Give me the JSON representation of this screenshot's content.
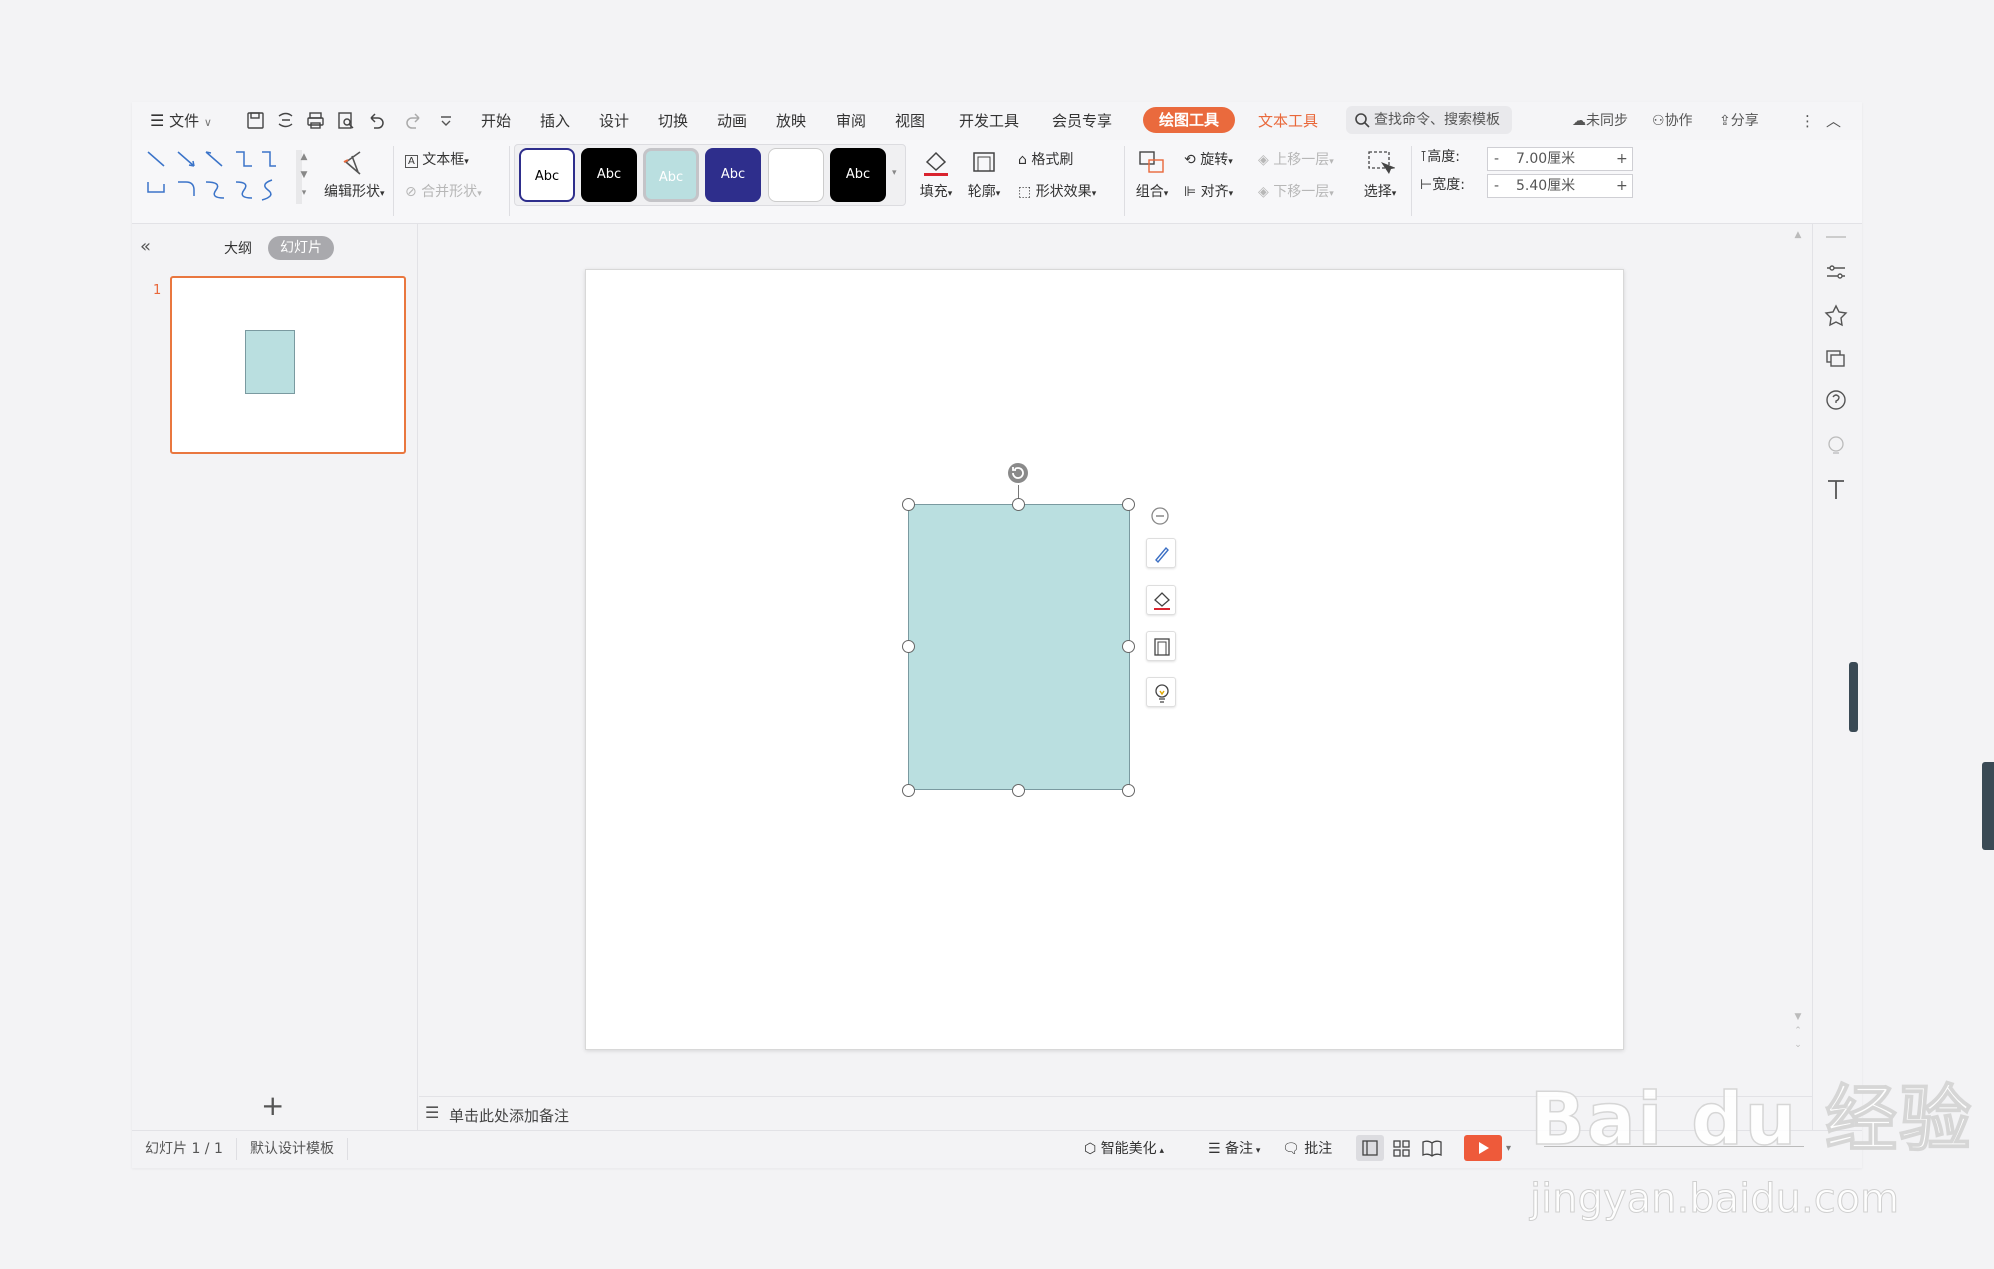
{
  "menu": {
    "file": "文件",
    "tabs": [
      "开始",
      "插入",
      "设计",
      "切换",
      "动画",
      "放映",
      "审阅",
      "视图",
      "开发工具",
      "会员专享"
    ],
    "active_tab": "绘图工具",
    "text_tool_tab": "文本工具",
    "search_placeholder": "查找命令、搜索模板",
    "unsynced": "未同步",
    "collaborate": "协作",
    "share": "分享"
  },
  "ribbon": {
    "edit_shape": "编辑形状",
    "text_box": "文本框",
    "merge_shape": "合并形状",
    "style_label": "Abc",
    "fill": "填充",
    "outline": "轮廓",
    "format_painter": "格式刷",
    "shape_effects": "形状效果",
    "group": "组合",
    "rotate": "旋转",
    "align": "对齐",
    "bring_forward": "上移一层",
    "send_backward": "下移一层",
    "select": "选择",
    "height_label": "高度:",
    "height_value": "7.00厘米",
    "width_label": "宽度:",
    "width_value": "5.40厘米",
    "minus": "-",
    "plus": "+"
  },
  "left_panel": {
    "outline_tab": "大纲",
    "slides_tab": "幻灯片",
    "slide_number": "1",
    "add": "+"
  },
  "notes_placeholder": "单击此处添加备注",
  "status": {
    "slide_count": "幻灯片 1 / 1",
    "template": "默认设计模板",
    "smart_beautify": "智能美化",
    "notes": "备注",
    "comments": "批注"
  },
  "watermark": {
    "brand": "Bai du 经验",
    "url": "jingyan.baidu.com"
  },
  "colors": {
    "accent": "#ea6a3d",
    "shape_fill": "#badfe0",
    "style_navy": "#2e2e8c",
    "play": "#ee5a3a"
  }
}
